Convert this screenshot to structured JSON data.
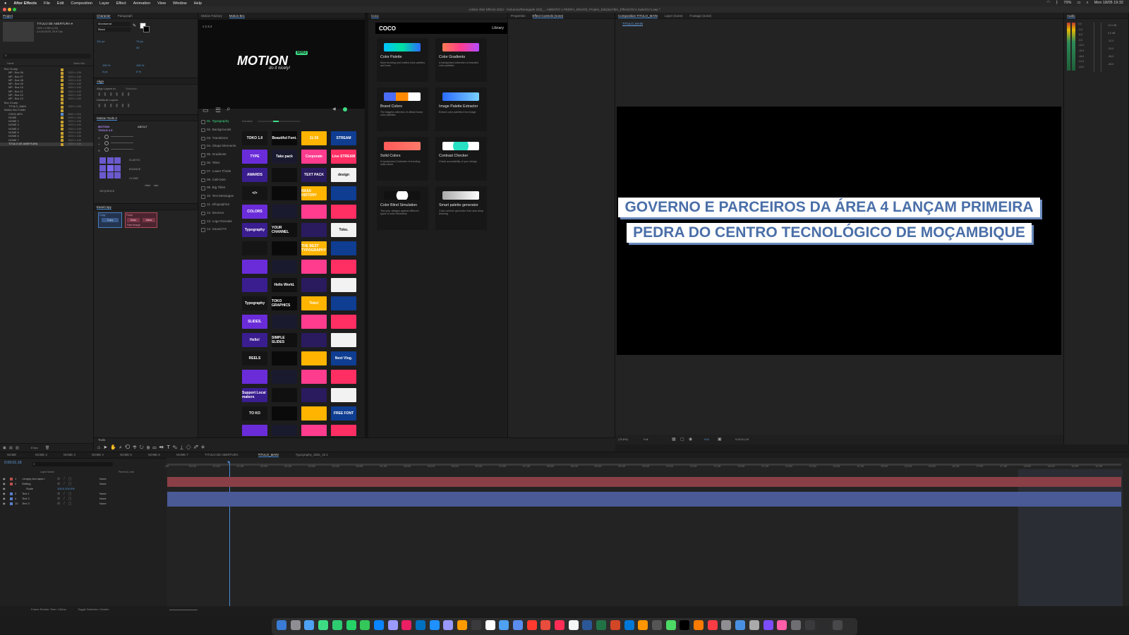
{
  "menubar": {
    "app_name": "After Effects",
    "items": [
      "File",
      "Edit",
      "Composition",
      "Layer",
      "Effect",
      "Animation",
      "View",
      "Window",
      "Help"
    ],
    "battery": "70%",
    "clock": "Mon 18/05 19:32"
  },
  "window_title": "Adobe After Effects 2024 - /Volumes/Renegade 2/02_...AMENTO 1 PEDRA_ENV/03_Projeto_Edição/After_Effects/Oc's Suite/Oc's.aep *",
  "project": {
    "tabs": [
      "Project"
    ],
    "selected_name": "TITULO DE ABERTURA ▾",
    "selected_info": "1920 x 1080 (1,00)\nΔ 0;00;05;00, 29,97 fps",
    "col_name": "Name",
    "col_video": "Video Info",
    "items": [
      {
        "name": "Box 04.aep",
        "size": "",
        "color": "#c8a030"
      },
      {
        "name": "MP - Box 06",
        "size": "1920 x 108",
        "color": "#c8a030"
      },
      {
        "name": "MP - Box 07",
        "size": "1920 x 108",
        "color": "#c8a030"
      },
      {
        "name": "MP - Box 08",
        "size": "1920 x 108",
        "color": "#c8a030"
      },
      {
        "name": "MP - Box 09",
        "size": "1920 x 108",
        "color": "#c8a030"
      },
      {
        "name": "MP - Box 10",
        "size": "1920 x 108",
        "color": "#c8a030"
      },
      {
        "name": "MP - Box 11",
        "size": "1920 x 108",
        "color": "#c8a030"
      },
      {
        "name": "MP - Box 12",
        "size": "1920 x 108",
        "color": "#c8a030"
      },
      {
        "name": "MP - Box 13",
        "size": "1920 x 108",
        "color": "#c8a030"
      },
      {
        "name": "Box 13.aep",
        "size": "",
        "color": "#c8a030"
      },
      {
        "name": "TITULO_MAIN",
        "size": "1920 x 108",
        "color": "#c8a030"
      },
      {
        "name": "Motion Bro Folder",
        "size": "",
        "color": "#c8a030"
      },
      {
        "name": "C0011.MP4",
        "size": "3840 x 216",
        "color": "#5a8fd0"
      },
      {
        "name": "NOME",
        "size": "1920 x 108",
        "color": "#c8a030"
      },
      {
        "name": "NOME 2",
        "size": "1920 x 108",
        "color": "#c8a030"
      },
      {
        "name": "NOME 3",
        "size": "1920 x 108",
        "color": "#c8a030"
      },
      {
        "name": "NOME 4",
        "size": "1920 x 108",
        "color": "#c8a030"
      },
      {
        "name": "NOME 5",
        "size": "1920 x 108",
        "color": "#c8a030"
      },
      {
        "name": "NOME 6",
        "size": "1920 x 108",
        "color": "#c8a030"
      },
      {
        "name": "NOME 7",
        "size": "1920 x 108",
        "color": "#c8a030"
      },
      {
        "name": "TITULO DE ABERTURA",
        "size": "1920 x 108",
        "color": "#c8a030",
        "selected": true
      }
    ],
    "footer_bpc": "8 bpc"
  },
  "character": {
    "tabs": [
      "Character",
      "Paragraph"
    ],
    "font": "Montserrat",
    "style": "Black",
    "size": "111 px",
    "leading": "74 px",
    "tracking": "40",
    "vscale": "100 %",
    "hscale": "100 %",
    "baseline": "0 px",
    "tsume": "0 %"
  },
  "align": {
    "title": "Align",
    "align_to": "Align Layers to:",
    "align_to_value": "Selection",
    "distribute": "Distribute Layers:"
  },
  "motion_tools": {
    "title": "Motion Tools 2",
    "logo": "MOTION TOOLS 2.3",
    "about": "ABOUT",
    "rows": [
      "X",
      "Y",
      "R"
    ],
    "elastic": "ELASTIC",
    "bounce": "BOUNCE",
    "clone": "CLONE",
    "sequence": "SEQUENCE",
    "offset": "offset",
    "step": "step"
  },
  "ease_copy": {
    "title": "EaseCopy",
    "copy_label": "Copy",
    "copy_btn": "Copy",
    "paste_label": "Paste",
    "ease_btn": "Ease",
    "value_btn": "Value",
    "pass_through": "Pass through"
  },
  "motion_bro": {
    "tabs": [
      "Motion Factory",
      "Motion Bro"
    ],
    "version": "v 2.3.4",
    "logo_text": "MOTION",
    "logo_badge": "BRO",
    "tagline": "do it nicely!",
    "duration_label": "Duration",
    "categories": [
      "01. Typography",
      "02. Backgrounds",
      "03. Transitions",
      "04. Shape Elements",
      "05. Gradients",
      "06. Titles",
      "07. Lower Thirds",
      "08. Call-Outs",
      "09. Big Titles",
      "10. Text Messages",
      "11. Infographics",
      "12. Devices",
      "13. Logo Reveals",
      "14. Sound FX"
    ],
    "thumbs": [
      [
        "TOKO 1.0",
        "Beautiful Font.",
        "11:30",
        "STREAM"
      ],
      [
        "TYPE",
        "Take pack",
        "Corporate",
        "Live STREAM"
      ],
      [
        "AWARDS",
        "",
        "TEXT PACK",
        "design"
      ],
      [
        "</>",
        "",
        "NASA HISTORY",
        ""
      ],
      [
        "COLORS",
        "",
        "",
        ""
      ],
      [
        "Typography",
        "YOUR CHANNEL",
        "",
        "Toko."
      ],
      [
        "",
        "",
        "THE BEST TYPOGRAPHY",
        ""
      ],
      [
        "",
        "",
        "",
        ""
      ],
      [
        "",
        "Hello World.",
        "",
        ""
      ],
      [
        "Typography",
        "TOKO GRAPHICS",
        "Toko!",
        ""
      ],
      [
        "SLIDES.",
        "",
        "",
        ""
      ],
      [
        "Hello!",
        "SIMPLE SLIDES",
        "",
        ""
      ],
      [
        "REELS",
        "",
        "",
        "Next Vlog."
      ],
      [
        "",
        "",
        "",
        ""
      ],
      [
        "Support Local makers",
        "",
        "",
        ""
      ],
      [
        "TO KO",
        "",
        "",
        "FREE FONT"
      ],
      [
        "",
        "",
        "",
        ""
      ]
    ]
  },
  "coco": {
    "tab": "Coco",
    "logo": "COCO",
    "library": "Library",
    "cards": [
      {
        "title": "Color Palette",
        "desc": "Most trending and crafted color palettes and hues"
      },
      {
        "title": "Color Gradients",
        "desc": "A handpicked collection of beautiful color palettes"
      },
      {
        "title": "Brand Colors",
        "desc": "The biggest collection of official brand color palettes"
      },
      {
        "title": "Image Palette Extractor",
        "desc": "Extract color palettes from image"
      },
      {
        "title": "Solid Colors",
        "desc": "A handpicked Collection of trending solid colors"
      },
      {
        "title": "Contrast Checker",
        "desc": "Check accessibility of your design"
      },
      {
        "title": "Color Blind Simulation",
        "desc": "Test your designs against different types of color blindness"
      },
      {
        "title": "Smart palette generator",
        "desc": "Color scheme generator that uses deep learning"
      }
    ]
  },
  "effect_tabs": [
    "Properties",
    "Effect Controls (none)"
  ],
  "composition": {
    "tabs": [
      "Composition TITULO_MAIN",
      "Layer (none)",
      "Footage (none)"
    ],
    "breadcrumb": "TITULO_MAIN",
    "headline_line1": "GOVERNO E PARCEIROS DA ÁREA 4 LANÇAM PRIMEIRA",
    "headline_line2": "PEDRA DO CENTRO TECNOLÓGICO DE MOÇAMBIQUE",
    "zoom": "(75,8%)",
    "resolution": "Full",
    "timecode": "0;00;01;18",
    "offset": "+0,0"
  },
  "audio": {
    "title": "Audio",
    "levels_left": [
      "0,0",
      "-3,0",
      "-6,0",
      "-9,0",
      "-12,0",
      "-15,0",
      "-18,0",
      "-21,0",
      "-24,0"
    ],
    "levels_right": [
      "12,0 dB",
      "0,0 dB",
      "-12,0",
      "-24,0",
      "-36,0",
      "-48,0"
    ]
  },
  "tools": {
    "title": "Tools"
  },
  "timeline": {
    "tabs": [
      "NOME",
      "NOME 2",
      "NOME 3",
      "NOME 4",
      "NOME 5",
      "NOME 6",
      "NOME 7",
      "TITULO DE ABERTURA",
      "TITULO_MAIN",
      "Typography_Slide_16 1"
    ],
    "active_tab": "TITULO_MAIN",
    "timecode": "0;00;01;18",
    "col_layer": "Layer Name",
    "col_parent": "Parent & Link",
    "layers": [
      {
        "num": "1",
        "name": "<empty text layer>",
        "parent": "None",
        "color": "#c0504d"
      },
      {
        "num": "2",
        "name": "Setting",
        "parent": "None",
        "color": "#c0504d"
      },
      {
        "num": "",
        "name": "Scale",
        "parent": "",
        "color": "",
        "value": "100,0,100,0%"
      },
      {
        "num": "3",
        "name": "Text 1",
        "parent": "None",
        "color": "#5a7fd0"
      },
      {
        "num": "4",
        "name": "Text 2",
        "parent": "None",
        "color": "#5a7fd0"
      },
      {
        "num": "10",
        "name": "Text 3",
        "parent": "None",
        "color": "#5a7fd0"
      }
    ],
    "ruler": [
      "00f",
      "00:15f",
      "01:00f",
      "01:15f",
      "02:00f",
      "02:15f",
      "03:00f",
      "03:15f",
      "04:00f",
      "04:15f",
      "05:00f",
      "05:15f",
      "06:00f",
      "06:15f",
      "07:00f",
      "07:15f",
      "08:00f",
      "08:15f",
      "09:00f",
      "09:15f",
      "10:00f",
      "10:15f",
      "11:00f",
      "11:15f",
      "12:00f",
      "12:15f",
      "13:00f",
      "13:15f",
      "14:00f",
      "14:15f",
      "15:00f",
      "15:15f",
      "16:00f",
      "16:15f",
      "17:00f",
      "17:15f",
      "18:00f",
      "18:15f",
      "19:00f",
      "19:15f"
    ],
    "footer_render": "Frame Render Time: 148ms",
    "footer_toggle": "Toggle Switches / Modes"
  },
  "dock": {
    "colors": [
      "#3a7bd5",
      "#8e8e93",
      "#4ea1f3",
      "#3ddc84",
      "#2ecc71",
      "#25d366",
      "#34c759",
      "#0a84ff",
      "#9999ff",
      "#e91e63",
      "#0070c0",
      "#1e90ff",
      "#9999ff",
      "#ff9a00",
      "#3a3a3c",
      "#ffffff",
      "#4ea1f3",
      "#5b8def",
      "#ff3b30",
      "#e74c3c",
      "#ff2d55",
      "#f5f5f5",
      "#2b5797",
      "#217346",
      "#d24726",
      "#0078d7",
      "#ff9500",
      "#555555",
      "#4cd964",
      "#000000",
      "#ff7b00",
      "#fc3c44",
      "#8e8e93",
      "#4a90e2",
      "#aaaaaa",
      "#7c4dff",
      "#ff5ea8",
      "#6e6e73",
      "#3a3a3c",
      "#2c2c2e",
      "#48484a"
    ]
  }
}
